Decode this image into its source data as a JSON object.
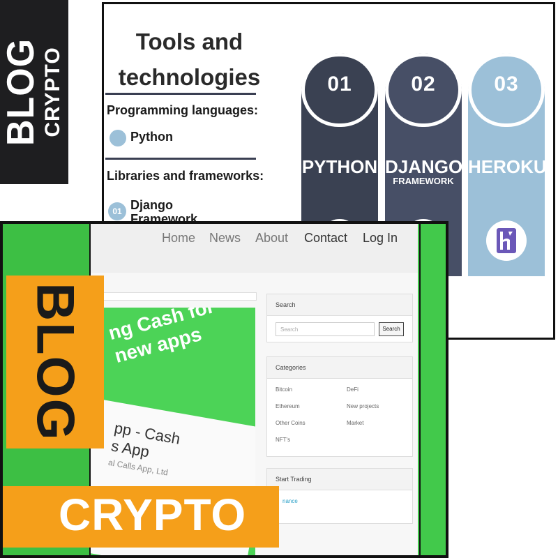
{
  "badge": {
    "line1": "BLOG",
    "line2": "CRYPTO"
  },
  "infographic": {
    "title_line1": "Tools and",
    "title_line2": "technologies",
    "section1_heading": "Programming languages:",
    "section1_item": "Python",
    "section2_heading": "Libraries and frameworks:",
    "section2_number": "01",
    "section2_item_line1": "Django",
    "section2_item_line2": "Framework",
    "pills": [
      {
        "number": "01",
        "label": "PYTHON",
        "sub": "",
        "color": "#3a4152"
      },
      {
        "number": "02",
        "label": "DJANGO",
        "sub": "FRAMEWORK",
        "color": "#474f66"
      },
      {
        "number": "03",
        "label": "HEROKU",
        "sub": "",
        "color": "#9cc0d8",
        "icon": "heroku-logo-icon"
      }
    ]
  },
  "site": {
    "nav": [
      "Home",
      "News",
      "About",
      "Contact",
      "Log In"
    ],
    "hero": {
      "headline_line1": "ng Cash for",
      "headline_line2": "new apps",
      "app_line1": "pp - Cash",
      "app_line2": "s App",
      "app_dev": "al Calls App, Ltd"
    },
    "search_widget": {
      "title": "Search",
      "placeholder": "Search",
      "button": "Search"
    },
    "categories_widget": {
      "title": "Categories",
      "left": [
        "Bitcoin",
        "Ethereum",
        "Other Coins",
        "NFT's"
      ],
      "right": [
        "DeFi",
        "New projects",
        "Market"
      ]
    },
    "trading_widget": {
      "title": "Start Trading",
      "link": "nance"
    }
  },
  "overlay": {
    "blog": "BLOG",
    "crypto": "CRYPTO"
  }
}
